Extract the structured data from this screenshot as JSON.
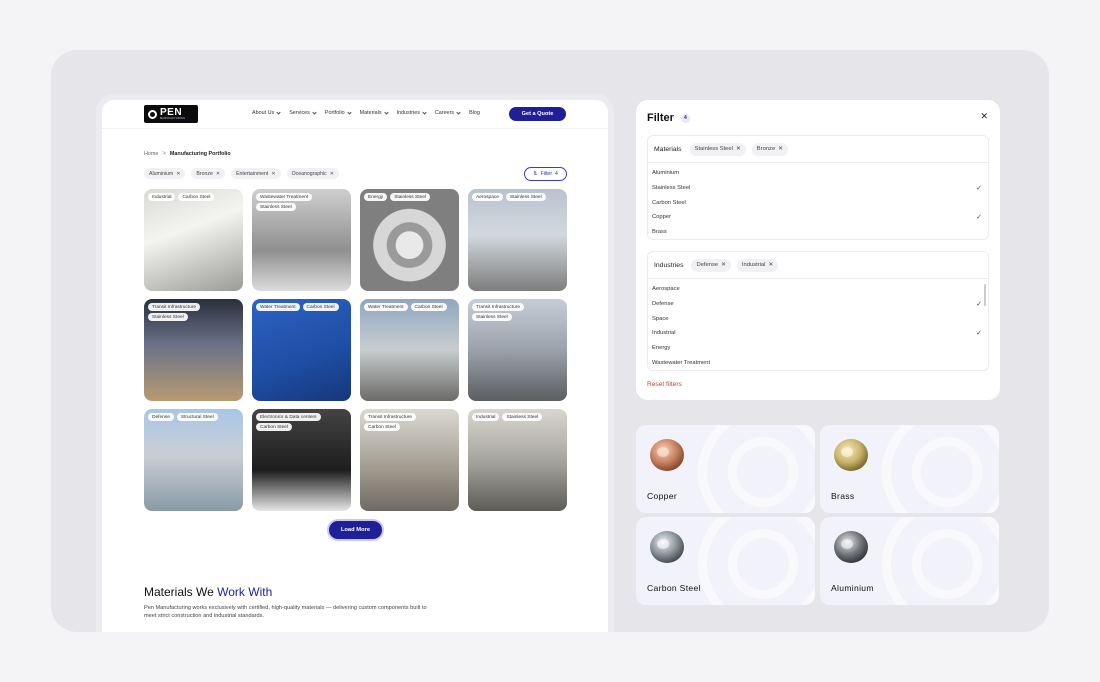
{
  "site": {
    "logo": {
      "main": "PEN",
      "sub": "MANUFACTURING"
    },
    "menu": [
      {
        "label": "About Us",
        "has_dropdown": true
      },
      {
        "label": "Services",
        "has_dropdown": true
      },
      {
        "label": "Portfolio",
        "has_dropdown": true
      },
      {
        "label": "Materials",
        "has_dropdown": true
      },
      {
        "label": "Industries",
        "has_dropdown": true
      },
      {
        "label": "Careers",
        "has_dropdown": true
      },
      {
        "label": "Blog",
        "has_dropdown": false
      }
    ],
    "cta": "Get a Quote",
    "breadcrumb": {
      "home": "Home",
      "separator": ">",
      "current": "Manufacturing Portfolio"
    },
    "active_filters": [
      "Aluminium",
      "Bronze",
      "Entertainment",
      "Oceanographic"
    ],
    "filter_button": {
      "label": "Filter",
      "count": "4"
    },
    "portfolio": [
      {
        "tags": [
          "Industrial",
          "Carbon Steel"
        ]
      },
      {
        "tags": [
          "Wastewater Treatment",
          "Stainless Steel"
        ]
      },
      {
        "tags": [
          "Energy",
          "Stainless Steel"
        ]
      },
      {
        "tags": [
          "Aerospace",
          "Stainless Steel"
        ]
      },
      {
        "tags": [
          "Transit Infrastructure",
          "Stainless Steel"
        ]
      },
      {
        "tags": [
          "Water Treatment",
          "Carbon Steel"
        ]
      },
      {
        "tags": [
          "Water Treatment",
          "Carbon Steel"
        ]
      },
      {
        "tags": [
          "Transit Infrastructure",
          "Stainless Steel"
        ]
      },
      {
        "tags": [
          "Defense",
          "Structural Steel"
        ]
      },
      {
        "tags": [
          "Electronics & Data centers",
          "Carbon Steel"
        ]
      },
      {
        "tags": [
          "Transit Infrastructure",
          "Carbon Steel"
        ]
      },
      {
        "tags": [
          "Industrial",
          "Stainless Steel"
        ]
      }
    ],
    "load_more": "Load More",
    "section": {
      "title_plain": "Materials We",
      "title_accent": "Work With",
      "description": "Pen Manufacturing works exclusively with certified, high-quality materials — delivering custom components built to meet strict construction and industrial standards."
    }
  },
  "filter_panel": {
    "title": "Filter",
    "badge": "4",
    "close_icon": "close-icon",
    "materials": {
      "label": "Materials",
      "selected": [
        "Stainless Steel",
        "Bronze"
      ],
      "options": [
        {
          "label": "Aluminium",
          "checked": false
        },
        {
          "label": "Stainless Steel",
          "checked": true
        },
        {
          "label": "Carbon Steel",
          "checked": false
        },
        {
          "label": "Copper",
          "checked": true
        },
        {
          "label": "Brass",
          "checked": false
        }
      ]
    },
    "industries": {
      "label": "Industries",
      "selected": [
        "Defense",
        "Industrial"
      ],
      "options": [
        {
          "label": "Aerospace",
          "checked": false
        },
        {
          "label": "Defense",
          "checked": true
        },
        {
          "label": "Space",
          "checked": false
        },
        {
          "label": "Industrial",
          "checked": true
        },
        {
          "label": "Energy",
          "checked": false
        },
        {
          "label": "Wastewater Treatment",
          "checked": false
        }
      ]
    },
    "reset": "Reset filters"
  },
  "materials_tiles": [
    {
      "label": "Copper",
      "color": "#c9825f"
    },
    {
      "label": "Brass",
      "color": "#c9b46a"
    },
    {
      "label": "Carbon Steel",
      "color": "#8d939c"
    },
    {
      "label": "Aluminium",
      "color": "#74777d"
    }
  ],
  "colors": {
    "brand": "#1f1f98",
    "reset": "#c0423f",
    "stage": "#e6e6ea",
    "tile": "#f2f2fb"
  }
}
